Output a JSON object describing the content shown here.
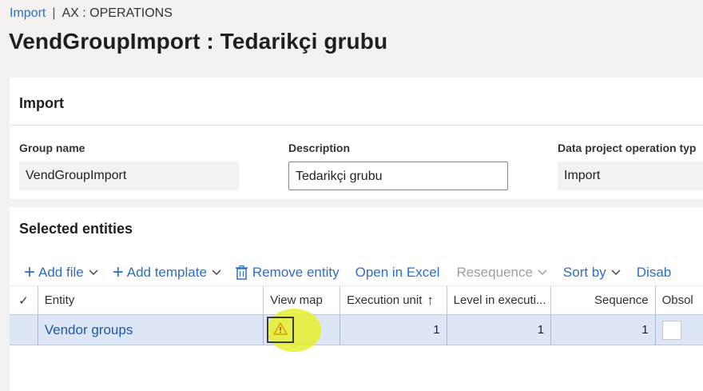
{
  "breadcrumb": {
    "link": "Import",
    "separator": "|",
    "current": "AX : OPERATIONS"
  },
  "page_title": "VendGroupImport : Tedarikçi grubu",
  "import_panel": {
    "title": "Import",
    "fields": {
      "group_name": {
        "label": "Group name",
        "value": "VendGroupImport"
      },
      "description": {
        "label": "Description",
        "value": "Tedarikçi grubu"
      },
      "operation_type": {
        "label": "Data project operation typ",
        "value": "Import"
      }
    }
  },
  "entities_panel": {
    "title": "Selected entities",
    "toolbar": {
      "add_file": "Add file",
      "add_template": "Add template",
      "remove_entity": "Remove entity",
      "open_in_excel": "Open in Excel",
      "resequence": "Resequence",
      "sort_by": "Sort by",
      "disable": "Disab"
    },
    "columns": {
      "check": "✓",
      "entity": "Entity",
      "view_map": "View map",
      "execution_unit": "Execution unit",
      "execution_unit_sort": "↑",
      "level": "Level in executi...",
      "sequence": "Sequence",
      "obsolete": "Obsol"
    },
    "rows": [
      {
        "entity": "Vendor groups",
        "view_map_icon": "warning-icon",
        "execution_unit": "1",
        "level": "1",
        "sequence": "1"
      }
    ]
  },
  "colors": {
    "accent": "#2b6fc5",
    "selected_row": "#dce6f6",
    "highlight": "#e6f03a",
    "warning": "#d8a400"
  }
}
